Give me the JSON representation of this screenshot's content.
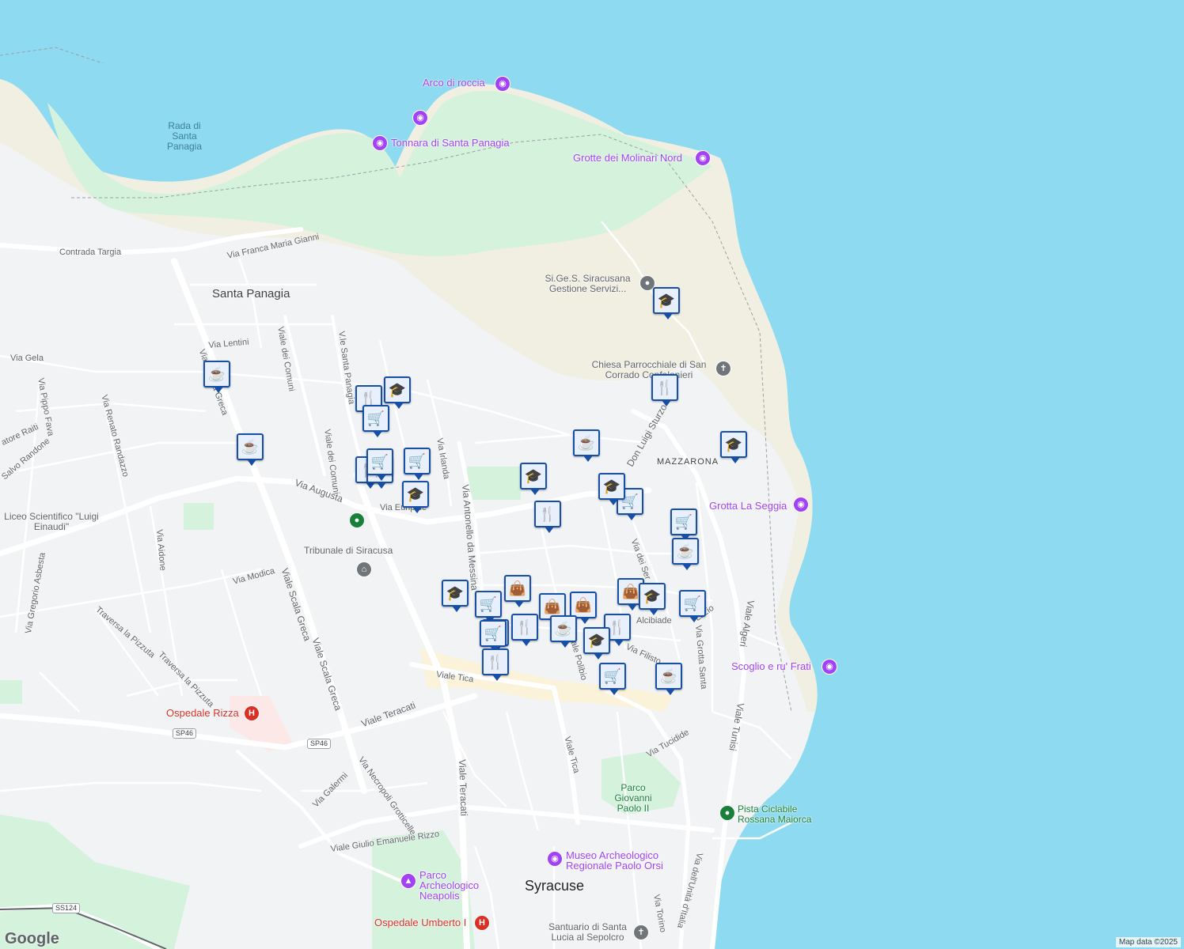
{
  "map": {
    "attribution": "Map data ©2025",
    "logo": "Google",
    "colors": {
      "sea": "#8edaf0",
      "land": "#f1f3f4",
      "park": "#d5f2dd",
      "sand": "#f1efe1",
      "road": "#ffffff",
      "marker_border": "#174ea6",
      "marker_fill": "#e8f0fe",
      "poi_purple": "#a142f4",
      "hospital_red": "#d93025",
      "park_green": "#188038"
    }
  },
  "places": {
    "city": "Syracuse",
    "santa_panagia": "Santa Panagia",
    "mazzarona": "MAZZARONA",
    "rada": "Rada di Santa Panagia",
    "parco_gp2": "Parco Giovanni Paolo II"
  },
  "poi": {
    "arco": "Arco di roccia",
    "tonnara": "Tonnara di Santa Panagia",
    "grotte": "Grotte dei Molinari Nord",
    "grotta_seggia": "Grotta La Seggia",
    "scoglio": "Scoglio e ru' Frati",
    "sigess": "Si.Ge.S. Siracusana Gestione Servizi...",
    "chiesa": "Chiesa Parrocchiale di San Corrado Confalonieri",
    "tribunale": "Tribunale di Siracusa",
    "liceo": "Liceo Scientifico \"Luigi Einaudi\"",
    "ospedale_rizza": "Ospedale Rizza",
    "ospedale_umberto": "Ospedale Umberto I",
    "pista": "Pista Ciclabile Rossana Maiorca",
    "museo": "Museo Archeologico Regionale Paolo Orsi",
    "parco_neapolis": "Parco Archeologico Neapolis",
    "santuario": "Santuario di Santa Lucia al Sepolcro"
  },
  "roads": {
    "contrada_targia": "Contrada Targia",
    "franca": "Via Franca Maria Gianni",
    "lentini": "Via Lentini",
    "gela": "Via Gela",
    "scala_greca_top": "Viale Scala Greca",
    "viale_comuni": "Viale dei Comuni",
    "santa_panagia_st": "V.le Santa Panagia",
    "pippo_fava": "Via Pippo Fava",
    "renato": "Via Renato Randazzo",
    "salvatore_raiti": "atore Raiti",
    "salvo_randone": "Salvo Randone",
    "augusta": "Via Augusta",
    "euripide": "Via Euripide",
    "irlanda": "Via Irlanda",
    "antonello": "Via Antonello da Messina",
    "don_luigi": "Don Luigi Sturzo",
    "aidone": "Via Aidone",
    "modica": "Via Modica",
    "gregorio": "Via Gregorio Asbesta",
    "traversa1": "Traversa la Pizzuta",
    "traversa2": "Traversa la Pizzuta",
    "scala_greca": "Viale Scala Greca",
    "scala_greca2": "Viale Scala Greca",
    "teracati": "Viale Teracati",
    "teracati_v": "Viale Teracati",
    "tica": "Viale Tica",
    "tica2": "Viale Tica",
    "polibio": "Viale Polibio",
    "tucidide": "Via Tucidide",
    "necropoli": "Via Necropoli Grotticelle",
    "galermi": "Via Galermi",
    "giulio": "Viale Giulio Emanuele Rizzo",
    "algeri": "Viale Algeri",
    "tunisi": "Viale Tunisi",
    "grotta_santa": "Via Grotta Santa",
    "torino": "Via Torino",
    "unita": "Via dell'Unità d'Italia",
    "filisto": "Via Filisto",
    "alcibiade": "Alcibiade",
    "lazio": "Lazio",
    "via_dei_ser": "Via dei Ser"
  },
  "shields": {
    "sp46a": "SP46",
    "sp46b": "SP46",
    "ss124": "SS124"
  },
  "markers": [
    {
      "icon": "cafe-icon",
      "glyph": "☕"
    },
    {
      "icon": "cafe-icon",
      "glyph": "☕"
    },
    {
      "icon": "restaurant-icon",
      "glyph": "🍴"
    },
    {
      "icon": "school-icon",
      "glyph": "🎓"
    },
    {
      "icon": "grocery-cart-icon",
      "glyph": "🛒"
    },
    {
      "icon": "restaurant-icon",
      "glyph": "🍴"
    },
    {
      "icon": "restaurant-icon",
      "glyph": "🍴"
    },
    {
      "icon": "grocery-cart-icon",
      "glyph": "🛒"
    },
    {
      "icon": "grocery-cart-icon",
      "glyph": "🛒"
    },
    {
      "icon": "school-icon",
      "glyph": "🎓"
    },
    {
      "icon": "school-icon",
      "glyph": "🎓"
    },
    {
      "icon": "restaurant-icon",
      "glyph": "🍴"
    },
    {
      "icon": "cafe-icon",
      "glyph": "☕"
    },
    {
      "icon": "school-icon",
      "glyph": "🎓"
    },
    {
      "icon": "grocery-cart-icon",
      "glyph": "🛒"
    },
    {
      "icon": "school-icon",
      "glyph": "🎓"
    },
    {
      "icon": "restaurant-icon",
      "glyph": "🍴"
    },
    {
      "icon": "school-icon",
      "glyph": "🎓"
    },
    {
      "icon": "grocery-cart-icon",
      "glyph": "🛒"
    },
    {
      "icon": "cafe-icon",
      "glyph": "☕"
    },
    {
      "icon": "school-icon",
      "glyph": "🎓"
    },
    {
      "icon": "grocery-cart-icon",
      "glyph": "🛒"
    },
    {
      "icon": "shopping-bag-icon",
      "glyph": "👜"
    },
    {
      "icon": "grocery-cart-icon",
      "glyph": "🛒"
    },
    {
      "icon": "grocery-cart-icon",
      "glyph": "🛒"
    },
    {
      "icon": "restaurant-icon",
      "glyph": "🍴"
    },
    {
      "icon": "restaurant-icon",
      "glyph": "🍴"
    },
    {
      "icon": "shopping-bag-icon",
      "glyph": "👜"
    },
    {
      "icon": "shopping-bag-icon",
      "glyph": "👜"
    },
    {
      "icon": "cafe-icon",
      "glyph": "☕"
    },
    {
      "icon": "restaurant-icon",
      "glyph": "🍴"
    },
    {
      "icon": "school-icon",
      "glyph": "🎓"
    },
    {
      "icon": "shopping-bag-icon",
      "glyph": "👜"
    },
    {
      "icon": "school-icon",
      "glyph": "🎓"
    },
    {
      "icon": "grocery-cart-icon",
      "glyph": "🛒"
    },
    {
      "icon": "grocery-cart-icon",
      "glyph": "🛒"
    },
    {
      "icon": "cafe-icon",
      "glyph": "☕"
    }
  ]
}
